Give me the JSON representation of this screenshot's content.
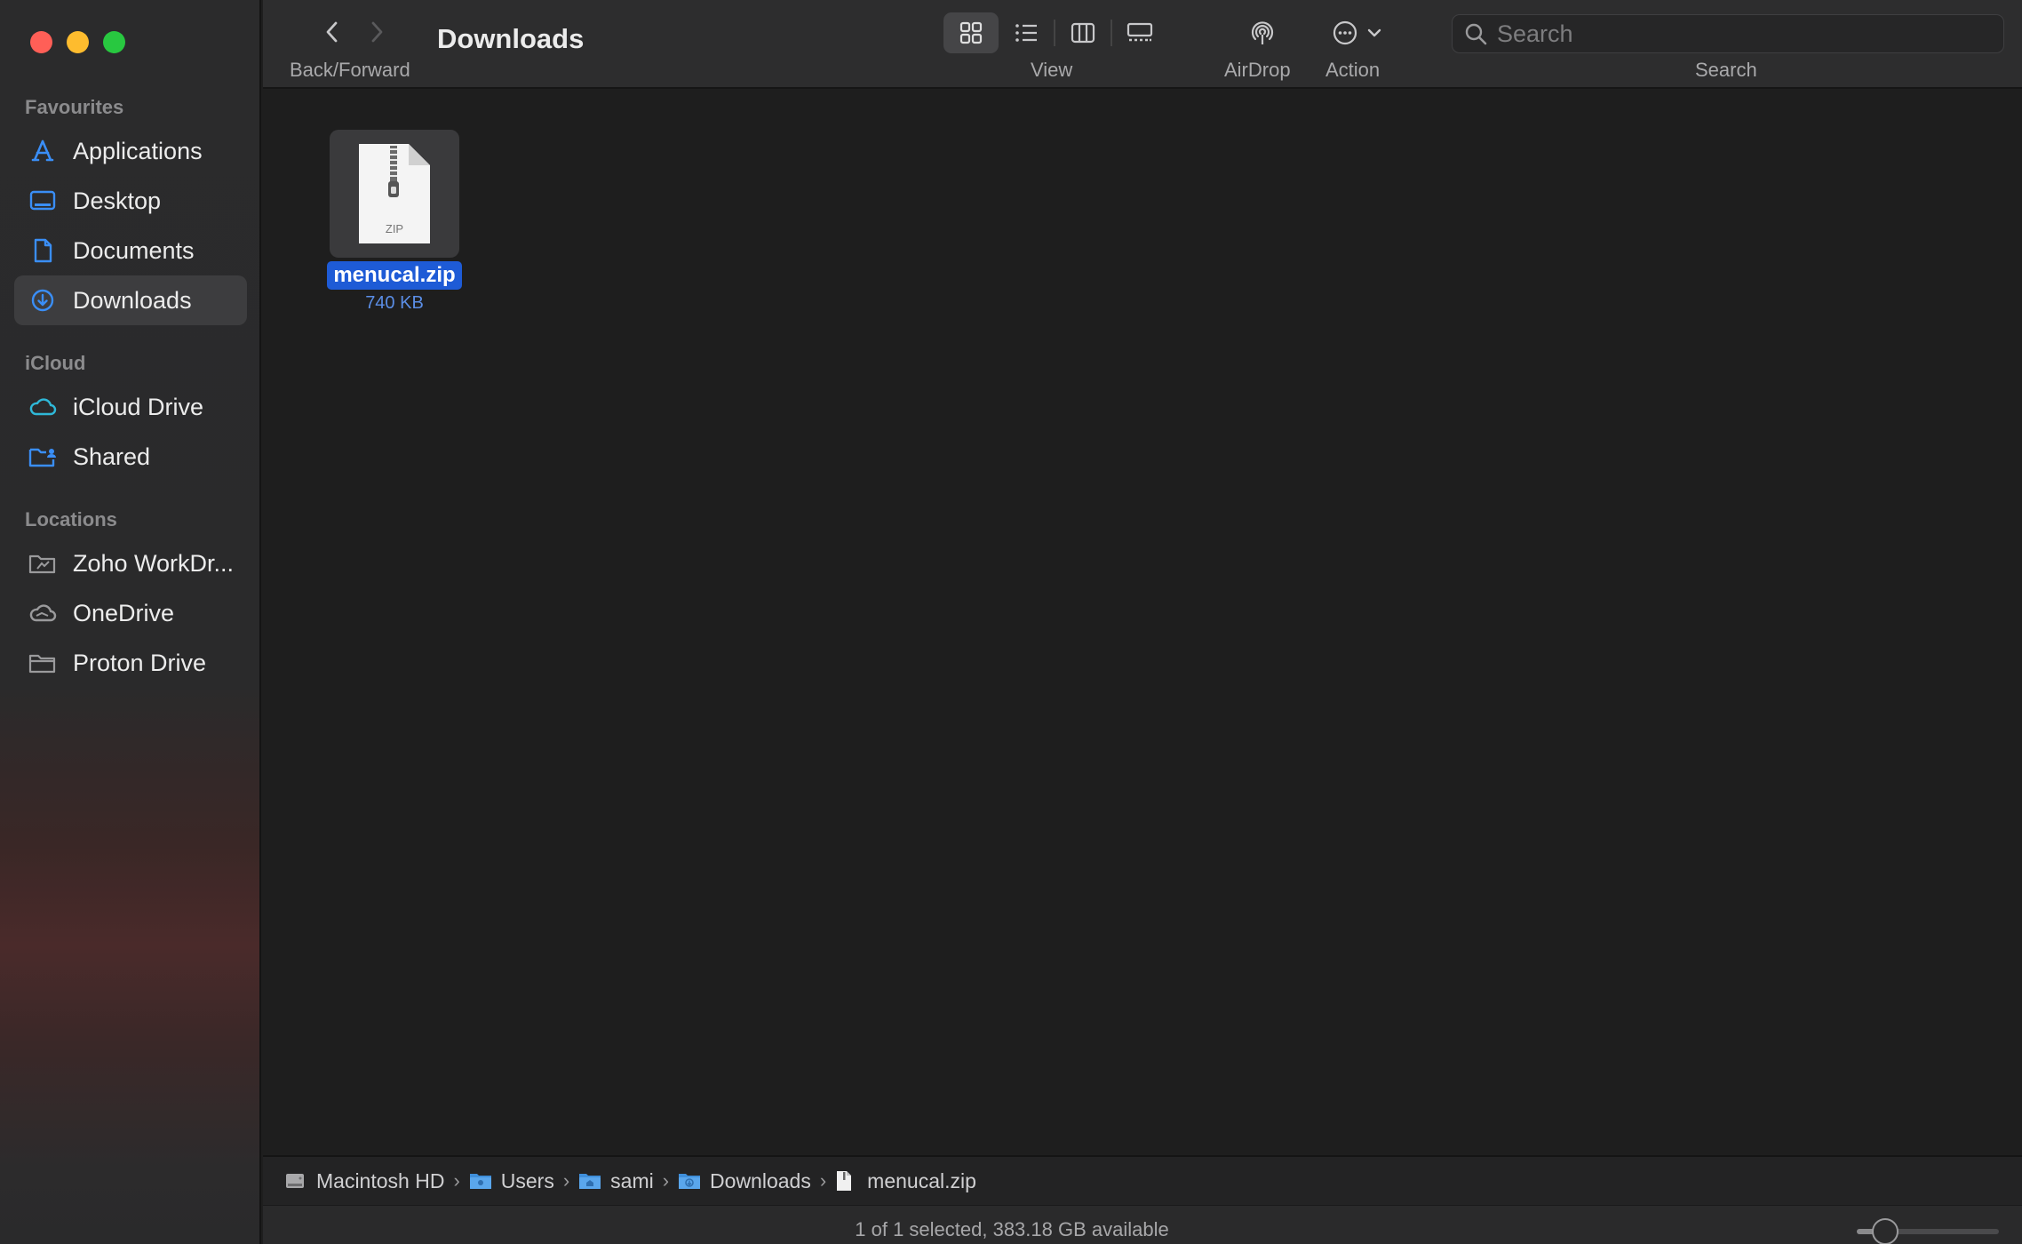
{
  "window": {
    "title": "Downloads"
  },
  "toolbar": {
    "back_forward_label": "Back/Forward",
    "view_label": "View",
    "airdrop_label": "AirDrop",
    "action_label": "Action",
    "search_label": "Search",
    "search_placeholder": "Search",
    "search_value": "",
    "view_modes": [
      "icon-view-icon",
      "list-view-icon",
      "column-view-icon",
      "gallery-view-icon"
    ],
    "selected_view": "icons"
  },
  "sidebar": {
    "favourites_heading": "Favourites",
    "favourites": [
      {
        "label": "Applications",
        "icon": "applications-icon"
      },
      {
        "label": "Desktop",
        "icon": "desktop-icon"
      },
      {
        "label": "Documents",
        "icon": "document-icon"
      },
      {
        "label": "Downloads",
        "icon": "downloads-icon",
        "active": true
      }
    ],
    "icloud_heading": "iCloud",
    "icloud": [
      {
        "label": "iCloud Drive",
        "icon": "cloud-icon"
      },
      {
        "label": "Shared",
        "icon": "shared-folder-icon"
      }
    ],
    "locations_heading": "Locations",
    "locations": [
      {
        "label": "Zoho WorkDr...",
        "icon": "drive-folder-icon"
      },
      {
        "label": "OneDrive",
        "icon": "cloud-icon"
      },
      {
        "label": "Proton Drive",
        "icon": "folder-icon"
      }
    ]
  },
  "files": [
    {
      "name": "menucal.zip",
      "size": "740 KB",
      "badge": "ZIP",
      "selected": true
    }
  ],
  "pathbar": {
    "items": [
      {
        "label": "Macintosh HD",
        "icon": "hard-drive-icon"
      },
      {
        "label": "Users",
        "icon": "folder-icon"
      },
      {
        "label": "sami",
        "icon": "home-folder-icon"
      },
      {
        "label": "Downloads",
        "icon": "downloads-folder-icon"
      },
      {
        "label": "menucal.zip",
        "icon": "file-icon"
      }
    ]
  },
  "statusbar": {
    "text": "1 of 1 selected, 383.18 GB available",
    "icon_size_fraction": 0.2
  },
  "colors": {
    "accent": "#1e5bd6",
    "sidebar_icon": "#3a8ef6",
    "icloud_icon": "#2fb8d8",
    "close": "#ff5f57",
    "minimize": "#febc2e",
    "maximize": "#28c840"
  }
}
